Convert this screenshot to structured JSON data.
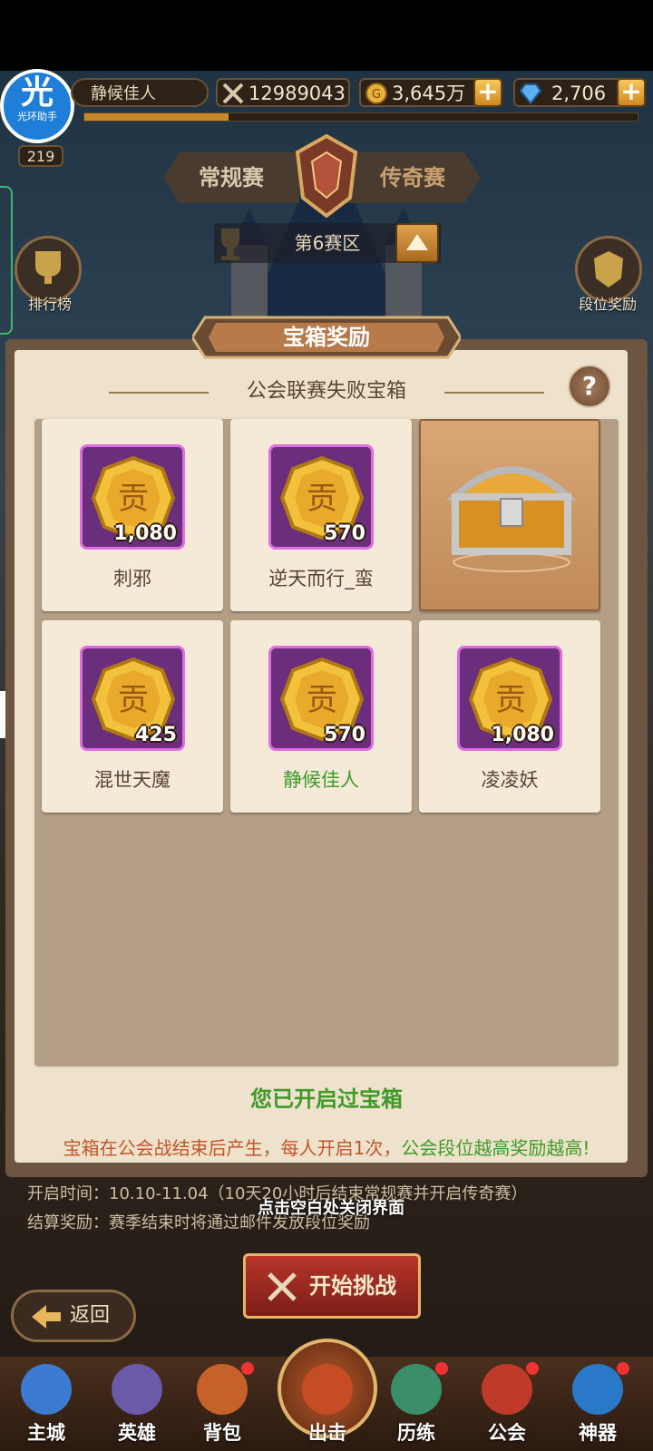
{
  "header": {
    "player_name": "静候佳人",
    "power": "12989043",
    "gold": "3,645万",
    "diamonds": "2,706",
    "level": "219",
    "xp_fraction": 0.26,
    "avatar_glyph": "光",
    "avatar_caption": "光环助手"
  },
  "mode_tabs": {
    "regular": "常规赛",
    "legend": "传奇赛"
  },
  "zone_label": "第6赛区",
  "side": {
    "ranking": "排行榜",
    "rank_rewards": "段位奖励"
  },
  "dialog": {
    "title": "宝箱奖励",
    "subtitle": "公会联赛失败宝箱",
    "help": "?",
    "rewards": [
      {
        "name": "刺邪",
        "amount": "1,080",
        "type": "coin",
        "is_self": false
      },
      {
        "name": "逆天而行_蛮",
        "amount": "570",
        "type": "coin",
        "is_self": false
      },
      {
        "name": "",
        "amount": "",
        "type": "chest",
        "is_self": false
      },
      {
        "name": "混世天魔",
        "amount": "425",
        "type": "coin",
        "is_self": false
      },
      {
        "name": "静候佳人",
        "amount": "570",
        "type": "coin",
        "is_self": true
      },
      {
        "name": "凌凌妖",
        "amount": "1,080",
        "type": "coin",
        "is_self": false
      }
    ],
    "opened_status": "您已开启过宝箱",
    "note_part1": "宝箱在公会战结束后产生，每人开启1次，",
    "note_part2": "公会段位越高奖励越高!"
  },
  "bottom": {
    "open_time": "开启时间：10.10-11.04（10天20小时后结束常规赛并开启传奇赛）",
    "settle": "结算奖励：赛季结束时将通过邮件发放段位奖励",
    "close_hint": "点击空白处关闭界面",
    "start_button": "开始挑战",
    "back_button": "返回"
  },
  "nav": [
    {
      "label": "主城",
      "icon": "castle-icon",
      "color": "#3d7bd1"
    },
    {
      "label": "英雄",
      "icon": "knight-icon",
      "color": "#6a5aa8"
    },
    {
      "label": "背包",
      "icon": "backpack-icon",
      "color": "#c7612a"
    },
    {
      "label": "出击",
      "icon": "crossed-swords-icon",
      "color": "#c64c24"
    },
    {
      "label": "历练",
      "icon": "mask-icon",
      "color": "#3a8f6a"
    },
    {
      "label": "公会",
      "icon": "guild-icon",
      "color": "#c03a2a"
    },
    {
      "label": "神器",
      "icon": "orb-icon",
      "color": "#2a78c8"
    }
  ],
  "colors": {
    "accent_green": "#3f9a2a",
    "badge_purple": "#6b2e7d",
    "note_orange": "#c0552a"
  }
}
